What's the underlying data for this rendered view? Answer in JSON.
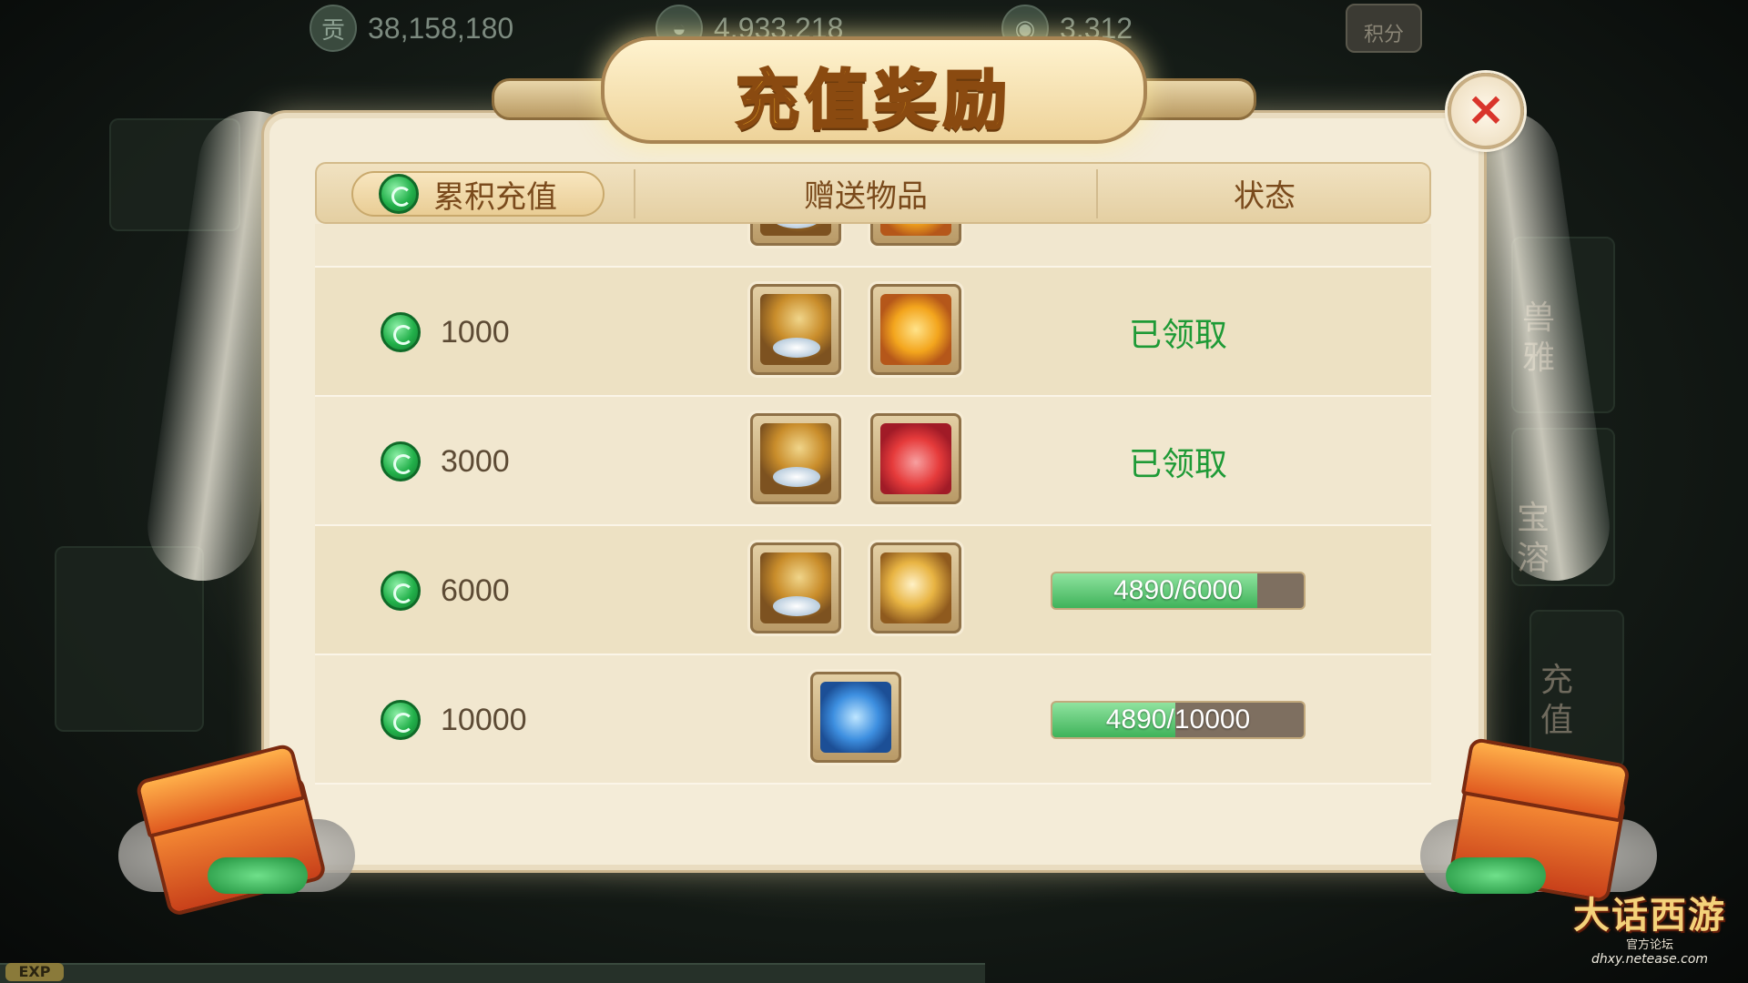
{
  "top_bar": {
    "currency1": {
      "icon": "contribution-icon",
      "icon_glyph": "贡",
      "value": "38,158,180"
    },
    "currency2": {
      "icon": "silver-ingot-icon",
      "value": "4,933,218"
    },
    "currency3": {
      "icon": "jade-coin-icon",
      "value": "3,312"
    },
    "score_button_label": "积分"
  },
  "background": {
    "side_text_1": "兽",
    "side_text_2": "雅",
    "side_text_3": "宝",
    "side_text_4": "溶",
    "side_text_5": "充",
    "side_text_6": "值",
    "exp_label": "EXP"
  },
  "dialog": {
    "title": "充值奖励",
    "close_icon": "×",
    "header": {
      "col1": "累积充值",
      "col2": "赠送物品",
      "col3": "状态"
    },
    "rows": [
      {
        "amount": "1000",
        "items": [
          "silver-bag-icon",
          "gold-lucky-bag-icon"
        ],
        "status_type": "claimed",
        "status_text": "已领取"
      },
      {
        "amount": "3000",
        "items": [
          "silver-bag-icon",
          "red-lucky-bag-icon"
        ],
        "status_type": "claimed",
        "status_text": "已领取"
      },
      {
        "amount": "6000",
        "items": [
          "silver-bag-icon",
          "golden-dragon-icon"
        ],
        "status_type": "progress",
        "progress_text": "4890/6000",
        "progress_current": 4890,
        "progress_target": 6000
      },
      {
        "amount": "10000",
        "items": [
          "blue-scroll-icon"
        ],
        "status_type": "progress",
        "progress_text": "4890/10000",
        "progress_current": 4890,
        "progress_target": 10000
      }
    ]
  },
  "watermark": {
    "logo": "大话西游",
    "subtitle": "官方论坛",
    "url": "dhxy.netease.com"
  },
  "colors": {
    "claimed_green": "#1e9a36",
    "header_text": "#7a4a1c",
    "close_red": "#d9352b",
    "progress_fill": "#3fb35a"
  }
}
